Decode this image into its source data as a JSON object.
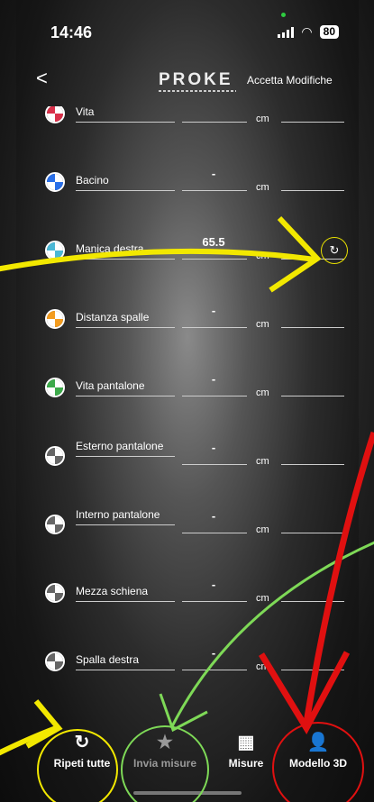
{
  "status": {
    "time": "14:46",
    "battery": "80"
  },
  "header": {
    "back": "<",
    "logo": "PROKE",
    "accept": "Accetta Modifiche"
  },
  "unit": "cm",
  "rows": [
    {
      "label": "Vita",
      "value": "",
      "color": "#d9304a"
    },
    {
      "label": "Bacino",
      "value": "-",
      "color": "#2a6fe8"
    },
    {
      "label": "Manica destra",
      "value": "65.5",
      "color": "#4bb8d6"
    },
    {
      "label": "Distanza spalle",
      "value": "-",
      "color": "#f39c1f"
    },
    {
      "label": "Vita pantalone",
      "value": "-",
      "color": "#3caa4a"
    },
    {
      "label": "Esterno pantalone",
      "value": "-",
      "color": "#666666"
    },
    {
      "label": "Interno pantalone",
      "value": "-",
      "color": "#666666"
    },
    {
      "label": "Mezza schiena",
      "value": "-",
      "color": "#666666"
    },
    {
      "label": "Spalla destra",
      "value": "-",
      "color": "#666666"
    }
  ],
  "nav": [
    {
      "label": "Ripeti tutte",
      "icon": "refresh-icon",
      "glyph": "↻"
    },
    {
      "label": "Invia misure",
      "icon": "star-icon",
      "glyph": "★"
    },
    {
      "label": "Misure",
      "icon": "grid-icon",
      "glyph": "▦"
    },
    {
      "label": "Modello 3D",
      "icon": "user-icon",
      "glyph": "👤"
    }
  ],
  "annotation_colors": {
    "yellow": "#f2e800",
    "green": "#7ed957",
    "red": "#e01010"
  }
}
